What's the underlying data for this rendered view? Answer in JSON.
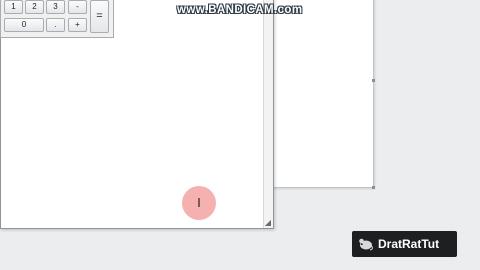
{
  "watermark": {
    "text": "www.BANDICAM.com"
  },
  "calculator": {
    "keys_row1": [
      "1",
      "2",
      "3",
      "-"
    ],
    "keys_row2": [
      "0",
      ".",
      "+"
    ],
    "equals_label": "="
  },
  "scrollbar": {
    "arrow": "▲"
  },
  "channel_badge": {
    "text": "DratRatTut"
  },
  "click_indicator": {
    "color": "#f29696"
  }
}
